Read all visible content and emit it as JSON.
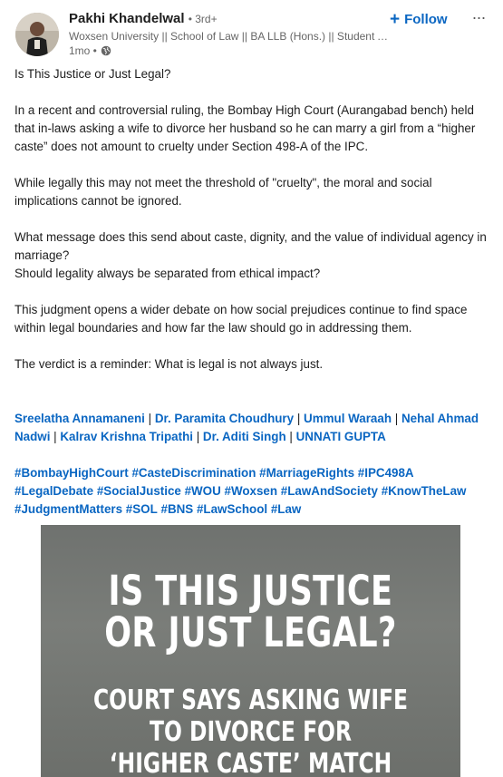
{
  "author": {
    "name": "Pakhi Khandelwal",
    "degree": "• 3rd+",
    "headline": "Woxsen University || School of Law || BA LLB (Hons.) || Student Ambassador",
    "time": "1mo •"
  },
  "actions": {
    "follow_label": "Follow",
    "more_label": "···"
  },
  "post": {
    "paragraphs": [
      "Is This Justice or Just Legal?",
      "In a recent and controversial ruling, the Bombay High Court (Aurangabad bench) held that in-laws asking a wife to divorce her husband so he can marry a girl from a “higher caste” does not amount to cruelty under Section 498-A of the IPC.",
      "While legally this may not meet the threshold of \"cruelty\", the moral and social implications cannot be ignored.",
      "What message does this send about caste, dignity, and the value of individual agency in marriage?",
      "Should legality always be separated from ethical impact?",
      "This judgment opens a wider debate on how social prejudices continue to find space within legal boundaries and how far the law should go in addressing them.",
      "The verdict is a reminder: What is legal is not always just."
    ],
    "mentions": [
      "Sreelatha Annamaneni",
      "Dr. Paramita Choudhury",
      "Ummul Waraah",
      "Nehal Ahmad Nadwi",
      "Kalrav Krishna Tripathi",
      "Dr. Aditi Singh",
      "UNNATI GUPTA"
    ],
    "hashtags": [
      "#BombayHighCourt",
      "#CasteDiscrimination",
      "#MarriageRights",
      "#IPC498A",
      "#LegalDebate",
      "#SocialJustice",
      "#WOU",
      "#Woxsen",
      "#LawAndSociety",
      "#KnowTheLaw",
      "#JudgmentMatters",
      "#SOL",
      "#BNS",
      "#LawSchool",
      "#Law"
    ]
  },
  "image": {
    "headline_line1": "IS THIS JUSTICE",
    "headline_line2": "OR JUST LEGAL?",
    "sub_line1": "COURT SAYS ASKING WIFE",
    "sub_line2": "TO DIVORCE FOR",
    "sub_line3": "‘HIGHER CASTE’ MATCH"
  },
  "icons": {
    "visibility": "globe-icon",
    "follow": "plus-icon",
    "more": "ellipsis-icon"
  }
}
